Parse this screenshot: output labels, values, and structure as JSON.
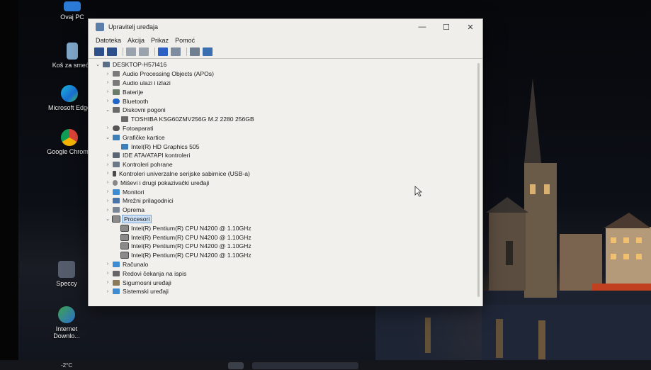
{
  "desktop": {
    "icons": [
      {
        "label": "Ovaj PC"
      },
      {
        "label": "Koš za smeće"
      },
      {
        "label": "Microsoft Edge"
      },
      {
        "label": "Google Chrome"
      },
      {
        "label": "Speccy"
      },
      {
        "label": "Internet Downlo..."
      }
    ]
  },
  "window": {
    "title": "Upravitelj uređaja",
    "controls": {
      "minimize": "—",
      "maximize": "☐",
      "close": "✕"
    }
  },
  "menu": [
    "Datoteka",
    "Akcija",
    "Prikaz",
    "Pomoć"
  ],
  "tree": [
    {
      "label": "DESKTOP-H57I416",
      "expanded": true
    },
    {
      "label": "Audio Processing Objects (APOs)"
    },
    {
      "label": "Audio ulazi i izlazi"
    },
    {
      "label": "Baterije"
    },
    {
      "label": "Bluetooth"
    },
    {
      "label": "Diskovni pogoni",
      "expanded": true
    },
    {
      "label": "TOSHIBA KSG60ZMV256G M.2 2280 256GB"
    },
    {
      "label": "Fotoaparati"
    },
    {
      "label": "Grafičke kartice",
      "expanded": true
    },
    {
      "label": "Intel(R) HD Graphics 505"
    },
    {
      "label": "IDE ATA/ATAPI kontroleri"
    },
    {
      "label": "Kontroleri pohrane"
    },
    {
      "label": "Kontroleri univerzalne serijske sabirnice (USB-a)"
    },
    {
      "label": "Miševi i drugi pokazivački uređaji"
    },
    {
      "label": "Monitori"
    },
    {
      "label": "Mrežni prilagodnici"
    },
    {
      "label": "Oprema"
    },
    {
      "label": "Procesori",
      "expanded": true,
      "selected": true
    },
    {
      "label": "Intel(R) Pentium(R) CPU N4200 @ 1.10GHz"
    },
    {
      "label": "Intel(R) Pentium(R) CPU N4200 @ 1.10GHz"
    },
    {
      "label": "Intel(R) Pentium(R) CPU N4200 @ 1.10GHz"
    },
    {
      "label": "Intel(R) Pentium(R) CPU N4200 @ 1.10GHz"
    },
    {
      "label": "Računalo"
    },
    {
      "label": "Redovi čekanja na ispis"
    },
    {
      "label": "Sigurnosni uređaji"
    },
    {
      "label": "Sistemski uređaji"
    }
  ],
  "taskbar": {
    "weather": "-2°C"
  },
  "colors": {
    "selection": "#cde0f5",
    "accent": "#0078d4"
  }
}
